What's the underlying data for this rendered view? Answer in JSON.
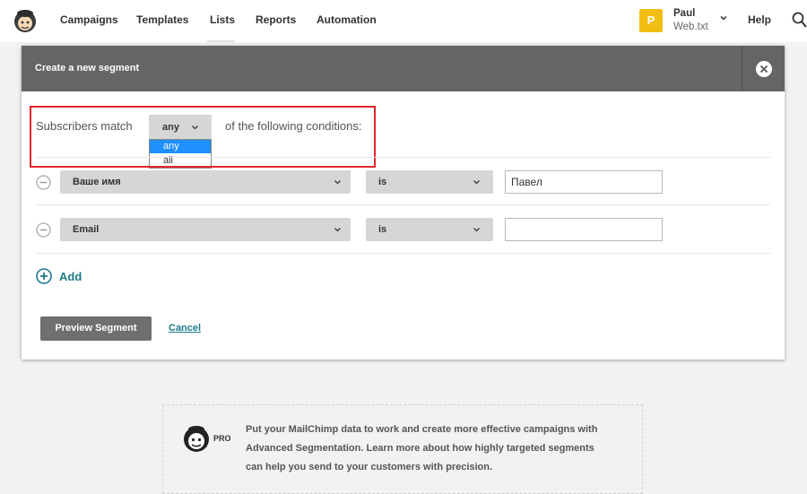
{
  "nav": {
    "items": [
      "Campaigns",
      "Templates",
      "Lists",
      "Reports",
      "Automation"
    ],
    "active": "Lists",
    "user": {
      "initial": "P",
      "name": "Paul",
      "account": "Web.txt"
    },
    "help": "Help"
  },
  "modal": {
    "title": "Create a new segment",
    "match": {
      "label": "Subscribers match",
      "selected": "any",
      "options": [
        "any",
        "all"
      ],
      "suffix": "of the following conditions:"
    },
    "conditions": [
      {
        "field": "Ваше имя",
        "operator": "is",
        "value": "Павел"
      },
      {
        "field": "Email",
        "operator": "is",
        "value": ""
      }
    ],
    "add_label": "Add",
    "preview_label": "Preview Segment",
    "cancel_label": "Cancel"
  },
  "promo": {
    "badge": "PRO",
    "lines": [
      "Put your MailChimp data to work and create more effective campaigns with",
      "Advanced Segmentation. Learn more about how highly targeted segments",
      "can help you send to your customers with precision."
    ]
  },
  "colors": {
    "accent": "#1b7b87",
    "highlight": "#e3242b",
    "header": "#656565",
    "avatar": "#f3be14"
  },
  "icons": [
    "mailchimp-logo-icon",
    "chevron-down-icon",
    "search-icon",
    "close-icon",
    "minus-circle-icon",
    "plus-circle-icon",
    "freddie-pro-icon"
  ]
}
